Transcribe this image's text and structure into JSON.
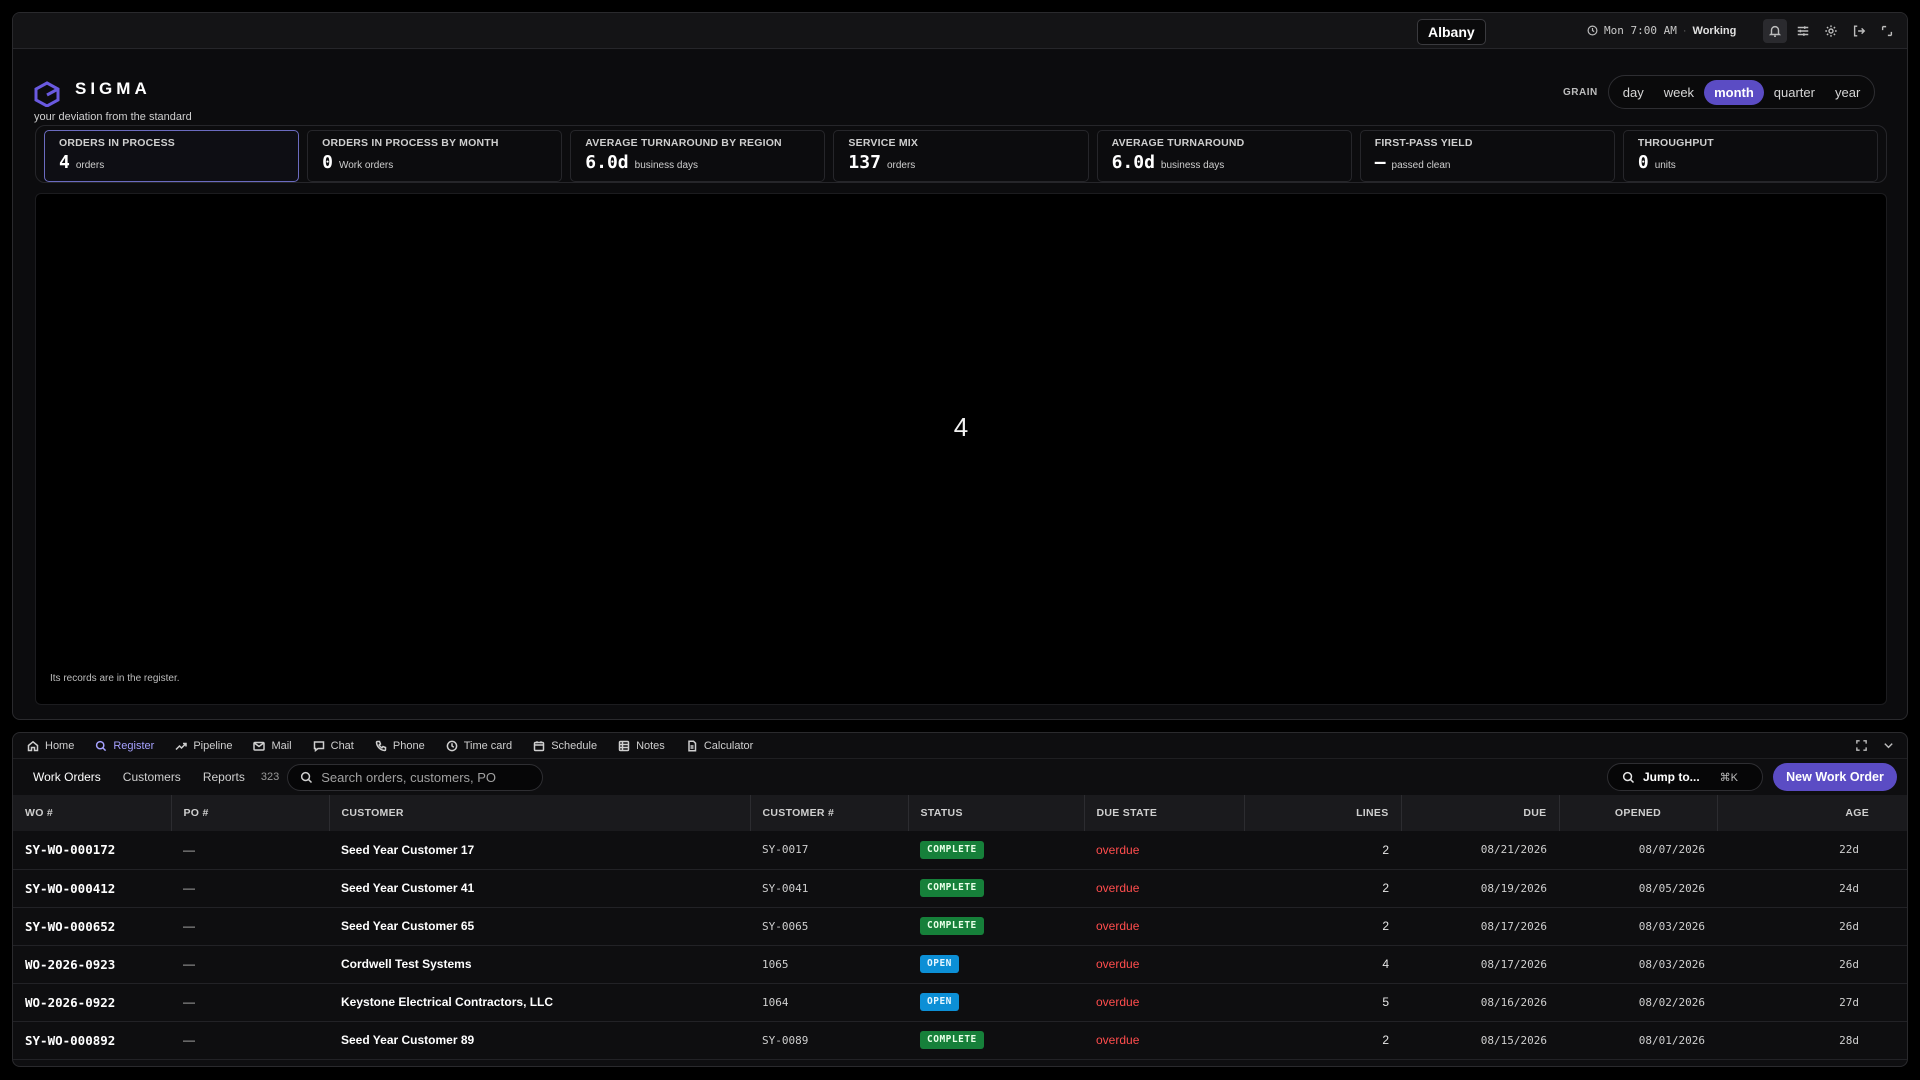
{
  "topbar": {
    "location": "Albany",
    "clock": "Mon 7:00 AM",
    "separator": "·",
    "state": "Working",
    "icons": [
      "bell-icon",
      "sliders-icon",
      "gear-icon",
      "logout-icon",
      "expand-icon"
    ]
  },
  "brand": {
    "name": "SIGMA",
    "tagline": "your deviation from the standard",
    "accent": "#5b4cc4"
  },
  "grain": {
    "label": "GRAIN",
    "options": [
      "day",
      "week",
      "month",
      "quarter",
      "year"
    ],
    "selected": "month"
  },
  "kpis": [
    {
      "label": "ORDERS IN PROCESS",
      "value": "4",
      "unit": "orders",
      "active": true
    },
    {
      "label": "ORDERS IN PROCESS BY MONTH",
      "value": "0",
      "unit": "Work orders"
    },
    {
      "label": "AVERAGE TURNAROUND BY REGION",
      "value": "6.0d",
      "unit": "business days"
    },
    {
      "label": "SERVICE MIX",
      "value": "137",
      "unit": "orders"
    },
    {
      "label": "AVERAGE TURNAROUND",
      "value": "6.0d",
      "unit": "business days"
    },
    {
      "label": "FIRST-PASS YIELD",
      "value": "—",
      "unit": "passed clean"
    },
    {
      "label": "THROUGHPUT",
      "value": "0",
      "unit": "units"
    }
  ],
  "chart": {
    "value": "4",
    "note": "Its records are in the register."
  },
  "nav": {
    "items": [
      {
        "label": "Home",
        "icon": "home-icon"
      },
      {
        "label": "Register",
        "icon": "search-icon",
        "active": true
      },
      {
        "label": "Pipeline",
        "icon": "trend-icon"
      },
      {
        "label": "Mail",
        "icon": "mail-icon"
      },
      {
        "label": "Chat",
        "icon": "chat-icon"
      },
      {
        "label": "Phone",
        "icon": "phone-icon"
      },
      {
        "label": "Time card",
        "icon": "clock-icon"
      },
      {
        "label": "Schedule",
        "icon": "calendar-icon"
      },
      {
        "label": "Notes",
        "icon": "grid-icon"
      },
      {
        "label": "Calculator",
        "icon": "calculator-icon"
      }
    ]
  },
  "register": {
    "tabs": [
      "Work Orders",
      "Customers",
      "Reports"
    ],
    "active_tab": "Work Orders",
    "count": "323",
    "search_placeholder": "Search orders, customers, PO",
    "jump_label": "Jump to...",
    "jump_shortcut": "⌘K",
    "new_button": "New Work Order",
    "columns": [
      "WO #",
      "PO #",
      "CUSTOMER",
      "CUSTOMER #",
      "STATUS",
      "DUE STATE",
      "LINES",
      "DUE",
      "OPENED",
      "AGE"
    ],
    "rows": [
      {
        "wo": "SY-WO-000172",
        "po": "—",
        "customer": "Seed Year Customer 17",
        "customer_no": "SY-0017",
        "status": "COMPLETE",
        "due_state": "overdue",
        "lines": "2",
        "due": "08/21/2026",
        "opened": "08/07/2026",
        "age": "22d"
      },
      {
        "wo": "SY-WO-000412",
        "po": "—",
        "customer": "Seed Year Customer 41",
        "customer_no": "SY-0041",
        "status": "COMPLETE",
        "due_state": "overdue",
        "lines": "2",
        "due": "08/19/2026",
        "opened": "08/05/2026",
        "age": "24d"
      },
      {
        "wo": "SY-WO-000652",
        "po": "—",
        "customer": "Seed Year Customer 65",
        "customer_no": "SY-0065",
        "status": "COMPLETE",
        "due_state": "overdue",
        "lines": "2",
        "due": "08/17/2026",
        "opened": "08/03/2026",
        "age": "26d"
      },
      {
        "wo": "WO-2026-0923",
        "po": "—",
        "customer": "Cordwell Test Systems",
        "customer_no": "1065",
        "status": "OPEN",
        "due_state": "overdue",
        "lines": "4",
        "due": "08/17/2026",
        "opened": "08/03/2026",
        "age": "26d"
      },
      {
        "wo": "WO-2026-0922",
        "po": "—",
        "customer": "Keystone Electrical Contractors, LLC",
        "customer_no": "1064",
        "status": "OPEN",
        "due_state": "overdue",
        "lines": "5",
        "due": "08/16/2026",
        "opened": "08/02/2026",
        "age": "27d"
      },
      {
        "wo": "SY-WO-000892",
        "po": "—",
        "customer": "Seed Year Customer 89",
        "customer_no": "SY-0089",
        "status": "COMPLETE",
        "due_state": "overdue",
        "lines": "2",
        "due": "08/15/2026",
        "opened": "08/01/2026",
        "age": "28d"
      }
    ]
  }
}
